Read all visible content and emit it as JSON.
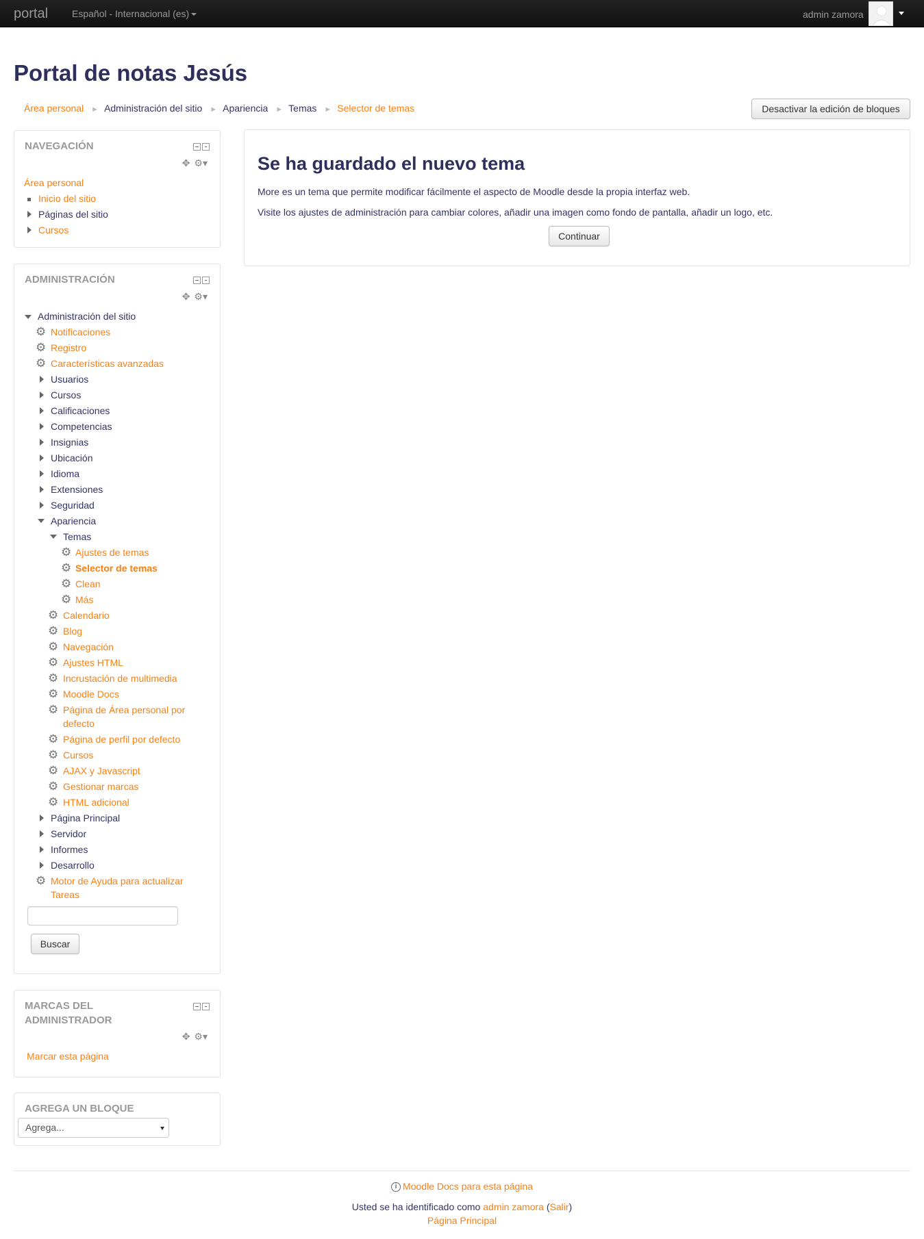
{
  "navbar": {
    "brand": "portal",
    "language": "Español - Internacional (es)",
    "user_name": "admin zamora"
  },
  "header": {
    "title": "Portal de notas Jesús",
    "breadcrumb": [
      "Área personal",
      "Administración del sitio",
      "Apariencia",
      "Temas",
      "Selector de temas"
    ],
    "edit_button": "Desactivar la edición de bloques"
  },
  "navigation_block": {
    "title": "NAVEGACIÓN",
    "items": [
      "Área personal",
      "Inicio del sitio",
      "Páginas del sitio",
      "Cursos"
    ]
  },
  "admin_block": {
    "title": "ADMINISTRACIÓN",
    "root": "Administración del sitio",
    "items": [
      "Notificaciones",
      "Registro",
      "Características avanzadas",
      "Usuarios",
      "Cursos",
      "Calificaciones",
      "Competencias",
      "Insignias",
      "Ubicación",
      "Idioma",
      "Extensiones",
      "Seguridad",
      "Apariencia",
      "Temas",
      "Ajustes de temas",
      "Selector de temas",
      "Clean",
      "Más",
      "Calendario",
      "Blog",
      "Navegación",
      "Ajustes HTML",
      "Incrustación de multimedia",
      "Moodle Docs",
      "Página de Área personal por",
      "defecto",
      "Página de perfil por defecto",
      "Cursos",
      "AJAX y Javascript",
      "Gestionar marcas",
      "HTML adicional",
      "Página Principal",
      "Servidor",
      "Informes",
      "Desarrollo",
      "Motor de Ayuda para actualizar",
      "Tareas"
    ],
    "search_button": "Buscar"
  },
  "bookmarks_block": {
    "title_line1": "MARCAS DEL",
    "title_line2": "ADMINISTRADOR",
    "link": "Marcar esta página"
  },
  "add_block": {
    "title": "AGREGA UN BLOQUE",
    "selected": "Agrega..."
  },
  "main": {
    "heading": "Se ha guardado el nuevo tema",
    "p1": "More es un tema que permite modificar fácilmente el aspecto de Moodle desde la propia interfaz web.",
    "p2": "Visite los ajustes de administración para cambiar colores, añadir una imagen como fondo de pantalla, añadir un logo, etc.",
    "continue_button": "Continuar"
  },
  "footer": {
    "docs_link": "Moodle Docs para esta página",
    "login_prefix": "Usted se ha identificado como",
    "login_user": "admin zamora",
    "logout_open": "(",
    "logout": "Salir",
    "logout_close": ")",
    "home": "Página Principal"
  },
  "colors": {
    "link": "#f98012",
    "text": "#333366",
    "navbar": "#111111"
  }
}
